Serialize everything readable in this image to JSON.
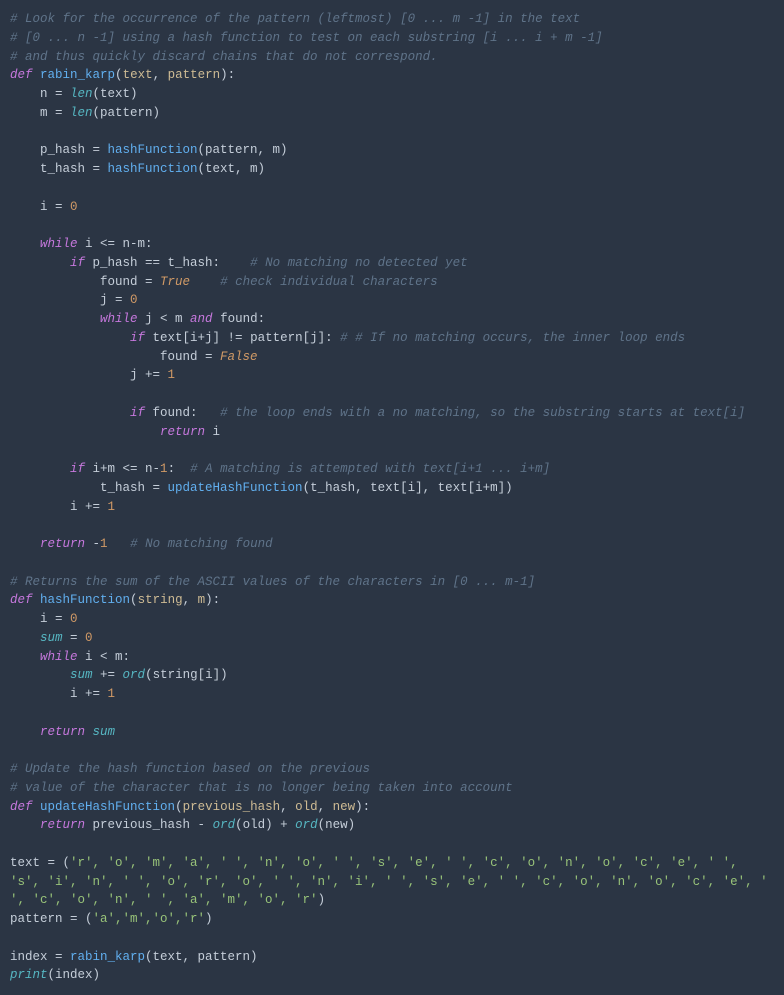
{
  "code": {
    "c1": "# Look for the occurrence of the pattern (leftmost) [0 ... m -1] in the text",
    "c2": "# [0 ... n -1] using a hash function to test on each substring [i ... i + m -1]",
    "c3": "# and thus quickly discard chains that do not correspond.",
    "def1": "def",
    "fn1": "rabin_karp",
    "p1": "text",
    "p2": "pattern",
    "ln5a": "n = ",
    "len": "len",
    "ln5b": "(text)",
    "ln6a": "m = ",
    "ln6b": "(pattern)",
    "ln8a": "p_hash = ",
    "hashFn": "hashFunction",
    "ln8b": "(pattern, m)",
    "ln9a": "t_hash = ",
    "ln9b": "(text, m)",
    "ln11": "i = ",
    "zero": "0",
    "while": "while",
    "ln13": " i <= n-m:",
    "if": "if",
    "ln14": " p_hash == t_hash:",
    "c4": "# No matching no detected yet",
    "ln15a": "found = ",
    "true": "True",
    "c5": "# check individual characters",
    "ln16": "j = ",
    "ln17": " j < m ",
    "and": "and",
    "ln17b": " found:",
    "ln18a": " text[i+j] != pattern[j]: ",
    "c6": "# # If no matching occurs, the inner loop ends",
    "ln19": "found = ",
    "false": "False",
    "ln20": "j += ",
    "one": "1",
    "ln22": " found:",
    "c7": "# the loop ends with a no matching, so the substring starts at text[i]",
    "return": "return",
    "ln23": " i",
    "ln25": " i+m <= n-",
    "ln25b": ":",
    "c8": "# A matching is attempted with text[i+1 ... i+m]",
    "ln26a": "t_hash = ",
    "updateFn": "updateHashFunction",
    "ln26b": "(t_hash, text[i], text[i+m])",
    "ln27": "i += ",
    "ln29": " -",
    "c9": "# No matching found",
    "c10": "# Returns the sum of the ASCII values of the characters in [0 ... m-1]",
    "fn2": "hashFunction",
    "p3": "string",
    "p4": "m",
    "ln33": "i = ",
    "sum": "sum",
    "ln34": " = ",
    "ln35": " i < m:",
    "ln36": " += ",
    "ord": "ord",
    "ln36b": "(string[i])",
    "ln37": "i += ",
    "ln39": " ",
    "c11": "# Update the hash function based on the previous",
    "c12": "# value of the character that is no longer being taken into account",
    "fn3": "updateHashFunction",
    "p5": "previous_hash",
    "p6": "old",
    "p7": "new",
    "ln44a": " previous_hash - ",
    "ln44b": "(old) + ",
    "ln44c": "(new)",
    "ln46a": "text = (",
    "tuple1": "'r', 'o', 'm', 'a', ' ', 'n', 'o', ' ', 's', 'e', ' ', 'c', 'o', 'n', 'o', 'c', 'e', ' ', 's', 'i', 'n', ' ', 'o', 'r', 'o', ' ', 'n', 'i', ' ', 's', 'e', ' ', 'c', 'o', 'n', 'o', 'c', 'e', ' ', 'c', 'o', 'n', ' ', 'a', 'm', 'o', 'r'",
    "ln46b": ")",
    "ln47a": "pattern = (",
    "tuple2": "'a','m','o','r'",
    "ln47b": ")",
    "ln49a": "index = ",
    "ln49b": "(text, pattern)",
    "print": "print",
    "ln50": "(index)"
  }
}
